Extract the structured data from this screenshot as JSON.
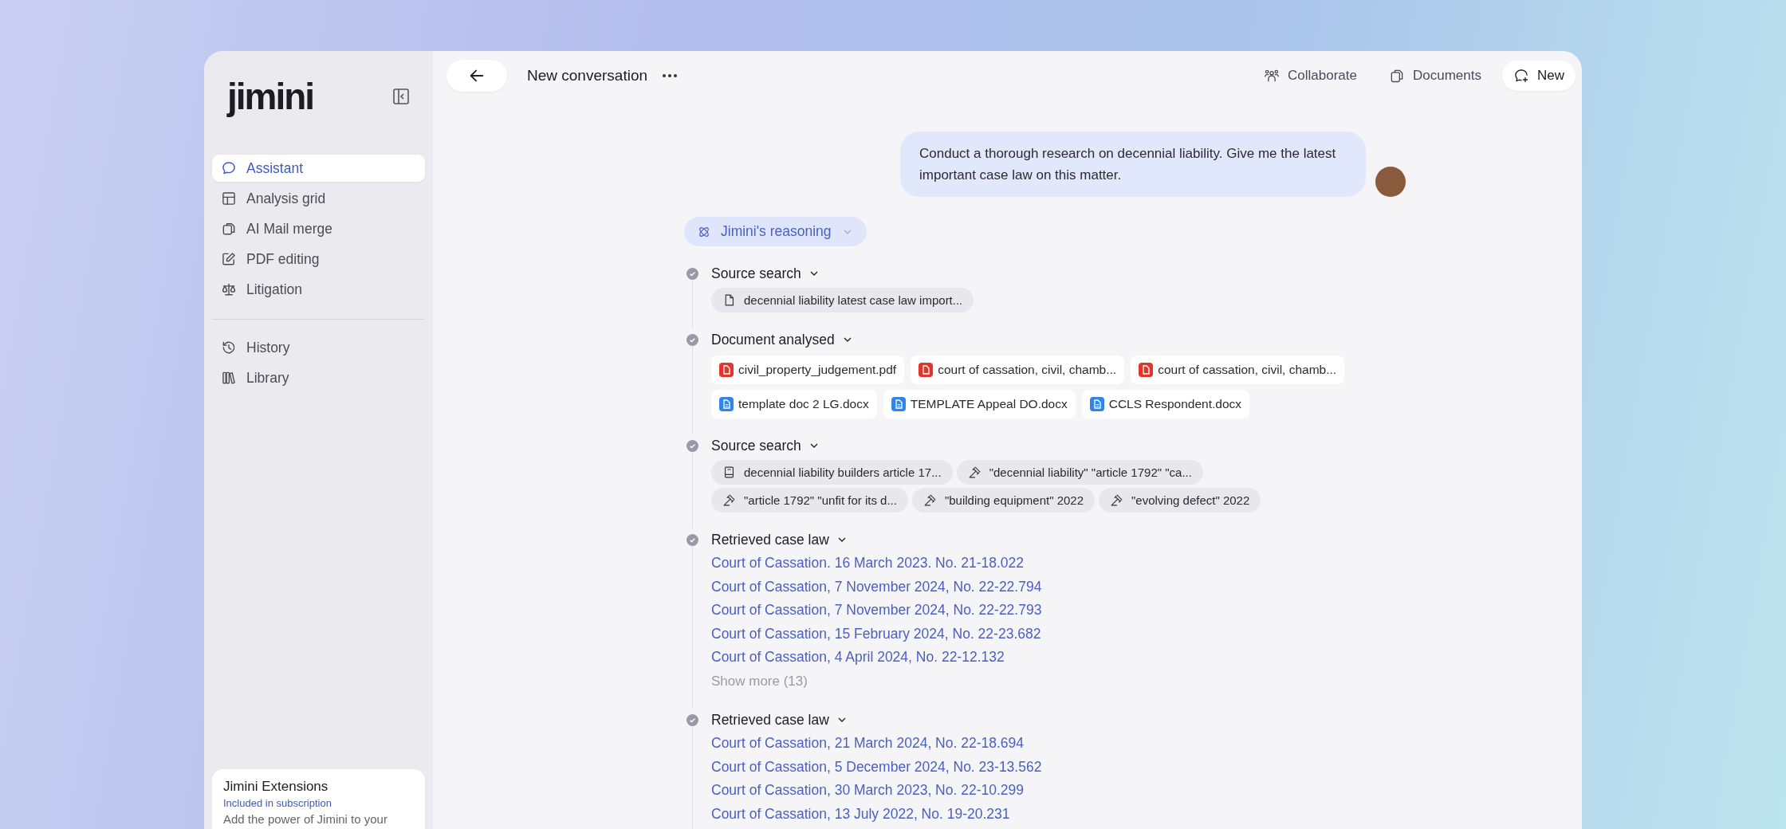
{
  "sidebar": {
    "logo": "jimini",
    "items": [
      {
        "label": "Assistant",
        "selected": true
      },
      {
        "label": "Analysis grid",
        "selected": false
      },
      {
        "label": "AI Mail merge",
        "selected": false
      },
      {
        "label": "PDF editing",
        "selected": false
      },
      {
        "label": "Litigation",
        "selected": false
      }
    ],
    "secondary_items": [
      {
        "label": "History",
        "selected": false
      },
      {
        "label": "Library",
        "selected": false
      }
    ],
    "extension_card": {
      "title": "Jimini Extensions",
      "subtitle": "Included in subscription",
      "body": "Add the power of Jimini to your"
    }
  },
  "topbar": {
    "title": "New conversation",
    "actions": [
      {
        "label": "Collaborate",
        "kind": "plain"
      },
      {
        "label": "Documents",
        "kind": "plain"
      },
      {
        "label": "New",
        "kind": "button"
      }
    ]
  },
  "message": {
    "text": "Conduct a thorough research on decennial liability. Give me the latest important case law on this matter."
  },
  "reasoning": {
    "label": "Jimini's reasoning"
  },
  "steps": [
    {
      "title": "Source search",
      "kind": "queries",
      "items": [
        {
          "label": "decennial liability latest case law import...",
          "kind": "document"
        }
      ]
    },
    {
      "title": "Document analysed",
      "kind": "files",
      "items": [
        {
          "label": "civil_property_judgement.pdf",
          "kind": "pdf"
        },
        {
          "label": "court of cassation, civil, chamb...",
          "kind": "pdf"
        },
        {
          "label": "court of cassation, civil, chamb...",
          "kind": "pdf"
        },
        {
          "label": "template doc 2 LG.docx",
          "kind": "docx"
        },
        {
          "label": "TEMPLATE Appeal DO.docx",
          "kind": "docx"
        },
        {
          "label": "CCLS Respondent.docx",
          "kind": "docx"
        }
      ]
    },
    {
      "title": "Source search",
      "kind": "queries",
      "items": [
        {
          "label": "decennial liability builders article 17...",
          "kind": "legislation"
        },
        {
          "label": "\"decennial liability\" \"article 1792\" \"ca...",
          "kind": "case-law"
        },
        {
          "label": "\"article 1792\" \"unfit for its d...",
          "kind": "case-law"
        },
        {
          "label": "\"building equipment\" 2022",
          "kind": "case-law"
        },
        {
          "label": "\"evolving defect\" 2022",
          "kind": "case-law"
        }
      ]
    },
    {
      "title": "Retrieved case law",
      "kind": "cases",
      "items": [
        {
          "label": "Court of Cassation. 16 March 2023. No. 21-18.022"
        },
        {
          "label": "Court of Cassation, 7 November 2024, No. 22-22.794"
        },
        {
          "label": "Court of Cassation, 7 November 2024, No. 22-22.793"
        },
        {
          "label": "Court of Cassation, 15 February 2024, No. 22-23.682"
        },
        {
          "label": "Court of Cassation, 4 April 2024, No. 22-12.132"
        }
      ],
      "show_more": "Show more (13)"
    },
    {
      "title": "Retrieved case law",
      "kind": "cases",
      "items": [
        {
          "label": "Court of Cassation, 21 March 2024, No. 22-18.694"
        },
        {
          "label": "Court of Cassation, 5 December 2024, No. 23-13.562"
        },
        {
          "label": "Court of Cassation, 30 March 2023, No. 22-10.299"
        },
        {
          "label": "Court of Cassation, 13 July 2022, No. 19-20.231"
        }
      ]
    }
  ]
}
